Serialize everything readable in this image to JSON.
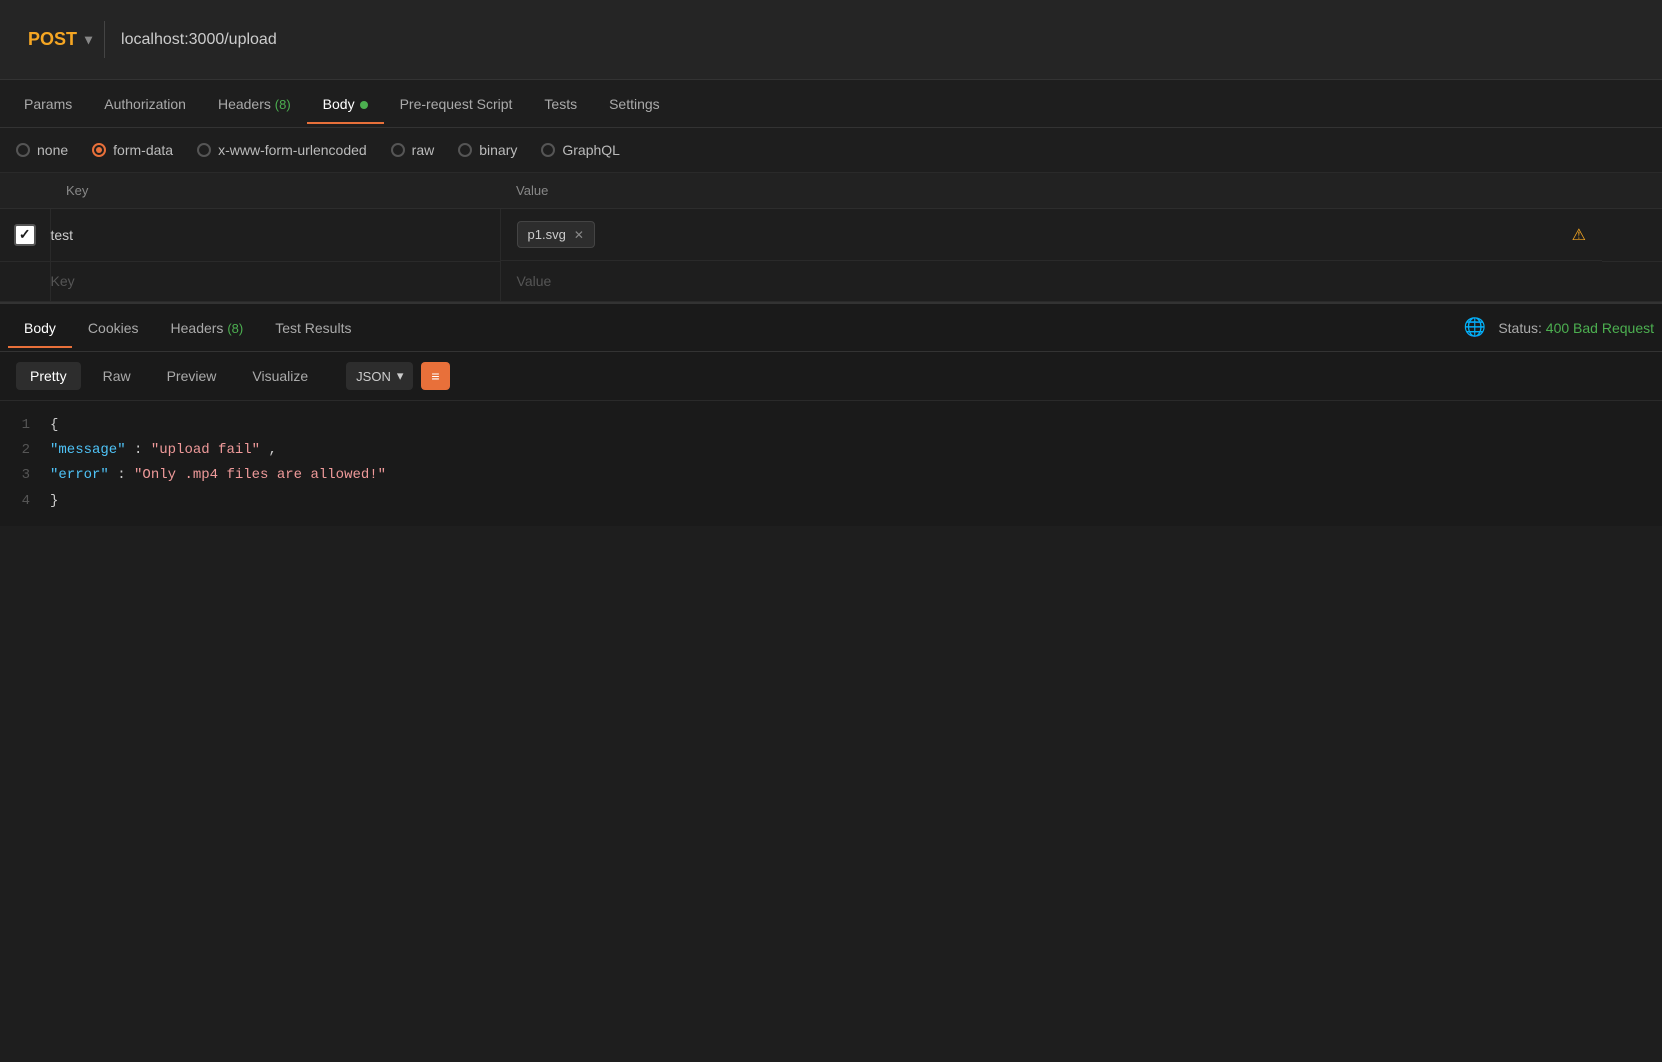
{
  "url_bar": {
    "method": "POST",
    "method_chevron": "▾",
    "url": "localhost:3000/upload"
  },
  "request_tabs": [
    {
      "id": "params",
      "label": "Params",
      "active": false,
      "badge": null,
      "dot": false
    },
    {
      "id": "authorization",
      "label": "Authorization",
      "active": false,
      "badge": null,
      "dot": false
    },
    {
      "id": "headers",
      "label": "Headers",
      "active": false,
      "badge": "(8)",
      "dot": false
    },
    {
      "id": "body",
      "label": "Body",
      "active": true,
      "badge": null,
      "dot": true
    },
    {
      "id": "pre-request-script",
      "label": "Pre-request Script",
      "active": false,
      "badge": null,
      "dot": false
    },
    {
      "id": "tests",
      "label": "Tests",
      "active": false,
      "badge": null,
      "dot": false
    },
    {
      "id": "settings",
      "label": "Settings",
      "active": false,
      "badge": null,
      "dot": false
    }
  ],
  "body_types": [
    {
      "id": "none",
      "label": "none",
      "checked": false
    },
    {
      "id": "form-data",
      "label": "form-data",
      "checked": true
    },
    {
      "id": "x-www-form-urlencoded",
      "label": "x-www-form-urlencoded",
      "checked": false
    },
    {
      "id": "raw",
      "label": "raw",
      "checked": false
    },
    {
      "id": "binary",
      "label": "binary",
      "checked": false
    },
    {
      "id": "graphql",
      "label": "GraphQL",
      "checked": false
    }
  ],
  "form_table": {
    "col_key": "Key",
    "col_value": "Value",
    "rows": [
      {
        "checked": true,
        "key": "test",
        "value_type": "file",
        "value": "p1.svg",
        "has_warning": true
      }
    ],
    "empty_row": {
      "key_placeholder": "Key",
      "value_placeholder": "Value"
    }
  },
  "response": {
    "tabs": [
      {
        "id": "body",
        "label": "Body",
        "active": true
      },
      {
        "id": "cookies",
        "label": "Cookies",
        "active": false
      },
      {
        "id": "headers",
        "label": "Headers (8)",
        "active": false
      },
      {
        "id": "test-results",
        "label": "Test Results",
        "active": false
      }
    ],
    "status_label": "Status:",
    "status_value": "400 Bad Request",
    "format_tabs": [
      {
        "id": "pretty",
        "label": "Pretty",
        "active": true
      },
      {
        "id": "raw",
        "label": "Raw",
        "active": false
      },
      {
        "id": "preview",
        "label": "Preview",
        "active": false
      },
      {
        "id": "visualize",
        "label": "Visualize",
        "active": false
      }
    ],
    "format_selector": "JSON",
    "format_chevron": "▾",
    "wrap_icon": "≡→",
    "json_lines": [
      {
        "num": 1,
        "content": "{",
        "type": "brace"
      },
      {
        "num": 2,
        "content": "    \"message\": \"upload fail\",",
        "type": "kv",
        "key": "message",
        "val": "upload fail",
        "comma": true
      },
      {
        "num": 3,
        "content": "    \"error\": \"Only .mp4 files are allowed!\"",
        "type": "kv",
        "key": "error",
        "val": "Only .mp4 files are allowed!",
        "comma": false
      },
      {
        "num": 4,
        "content": "}",
        "type": "brace"
      }
    ]
  }
}
